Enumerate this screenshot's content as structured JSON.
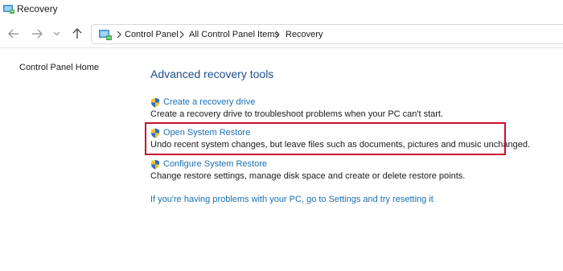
{
  "window": {
    "title": "Recovery",
    "icon": "control-panel-icon"
  },
  "nav": {
    "back_icon": "arrow-left-icon",
    "forward_icon": "arrow-right-icon",
    "recent_icon": "chevron-down-icon",
    "up_icon": "arrow-up-icon"
  },
  "address": {
    "icon": "control-panel-icon",
    "separator_icon": "chevron-right-icon",
    "crumbs": [
      "Control Panel",
      "All Control Panel Items",
      "Recovery"
    ]
  },
  "sidebar": {
    "home_label": "Control Panel Home"
  },
  "main": {
    "title": "Advanced recovery tools",
    "tasks": [
      {
        "link": "Create a recovery drive",
        "desc": "Create a recovery drive to troubleshoot problems when your PC can't start.",
        "icon": "uac-shield-icon"
      },
      {
        "link": "Open System Restore",
        "desc": "Undo recent system changes, but leave files such as documents, pictures and music unchanged.",
        "icon": "uac-shield-icon",
        "highlighted": true
      },
      {
        "link": "Configure System Restore",
        "desc": "Change restore settings, manage disk space and create or delete restore points.",
        "icon": "uac-shield-icon"
      }
    ],
    "reset_link": "If you're having problems with your PC, go to Settings and try resetting it"
  },
  "colors": {
    "link": "#1a6fb5",
    "heading": "#1e4e8c",
    "highlight_border": "#c8102e"
  }
}
